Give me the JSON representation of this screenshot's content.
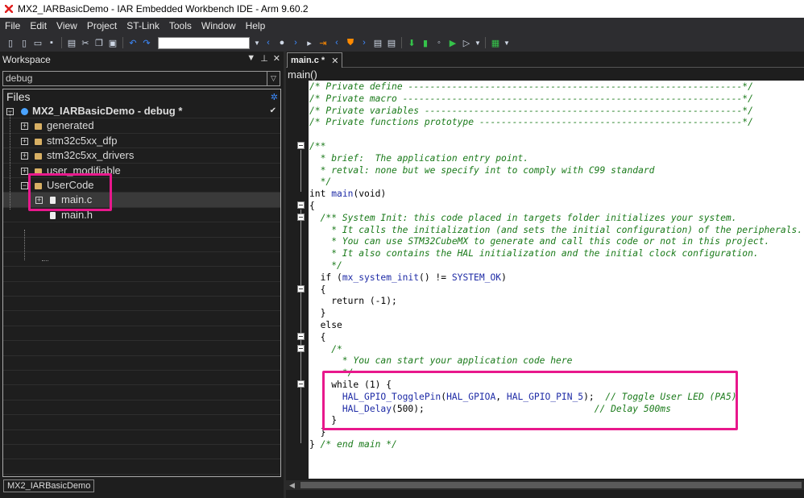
{
  "window": {
    "title": "MX2_IARBasicDemo - IAR Embedded Workbench IDE - Arm 9.60.2"
  },
  "menubar": {
    "items": [
      "File",
      "Edit",
      "View",
      "Project",
      "ST-Link",
      "Tools",
      "Window",
      "Help"
    ]
  },
  "workspace": {
    "header": "Workspace",
    "configuration": "debug",
    "files_header": "Files",
    "tree": [
      {
        "label": "MX2_IARBasicDemo - debug *",
        "kind": "project",
        "level": 0,
        "expander": "minus",
        "bold": true
      },
      {
        "label": "generated",
        "kind": "folder",
        "level": 1,
        "expander": "plus"
      },
      {
        "label": "stm32c5xx_dfp",
        "kind": "folder",
        "level": 1,
        "expander": "plus"
      },
      {
        "label": "stm32c5xx_drivers",
        "kind": "folder",
        "level": 1,
        "expander": "plus"
      },
      {
        "label": "user_modifiable",
        "kind": "folder",
        "level": 1,
        "expander": "plus"
      },
      {
        "label": "UserCode",
        "kind": "folder",
        "level": 1,
        "expander": "minus"
      },
      {
        "label": "main.c",
        "kind": "file",
        "level": 2,
        "expander": "plus",
        "selected": true
      },
      {
        "label": "main.h",
        "kind": "file",
        "level": 2,
        "expander": "none"
      }
    ],
    "bottom_tab": "MX2_IARBasicDemo"
  },
  "editor": {
    "tab_label": "main.c *",
    "function_bar": "main()",
    "code_lines": [
      [
        {
          "t": "/* Private define -------------------------------------------------------------*/",
          "c": "com"
        }
      ],
      [
        {
          "t": "/* Private macro --------------------------------------------------------------*/",
          "c": "com"
        }
      ],
      [
        {
          "t": "/* Private variables ----------------------------------------------------------*/",
          "c": "com"
        }
      ],
      [
        {
          "t": "/* Private functions prototype ------------------------------------------------*/",
          "c": "com"
        }
      ],
      [],
      [
        {
          "t": "/**",
          "c": "com"
        }
      ],
      [
        {
          "t": "  * brief:  The application entry point.",
          "c": "com"
        }
      ],
      [
        {
          "t": "  * retval: none but we specify int to comply with C99 standard",
          "c": "com"
        }
      ],
      [
        {
          "t": "  */",
          "c": "com"
        }
      ],
      [
        {
          "t": "int ",
          "c": "kw"
        },
        {
          "t": "main",
          "c": "fn"
        },
        {
          "t": "(void)",
          "c": "kw"
        }
      ],
      [
        {
          "t": "{",
          "c": "kw"
        }
      ],
      [
        {
          "t": "  /** System Init: this code placed in targets folder initializes your system.",
          "c": "com"
        }
      ],
      [
        {
          "t": "    * It calls the initialization (and sets the initial configuration) of the peripherals.",
          "c": "com"
        }
      ],
      [
        {
          "t": "    * You can use STM32CubeMX to generate and call this code or not in this project.",
          "c": "com"
        }
      ],
      [
        {
          "t": "    * It also contains the HAL initialization and the initial clock configuration.",
          "c": "com"
        }
      ],
      [
        {
          "t": "    */",
          "c": "com"
        }
      ],
      [
        {
          "t": "  if (",
          "c": "kw"
        },
        {
          "t": "mx_system_init",
          "c": "fn"
        },
        {
          "t": "() != ",
          "c": "kw"
        },
        {
          "t": "SYSTEM_OK",
          "c": "mac"
        },
        {
          "t": ")",
          "c": "kw"
        }
      ],
      [
        {
          "t": "  {",
          "c": "kw"
        }
      ],
      [
        {
          "t": "    return (-1);",
          "c": "kw"
        }
      ],
      [
        {
          "t": "  }",
          "c": "kw"
        }
      ],
      [
        {
          "t": "  else",
          "c": "kw"
        }
      ],
      [
        {
          "t": "  {",
          "c": "kw"
        }
      ],
      [
        {
          "t": "    /*",
          "c": "com"
        }
      ],
      [
        {
          "t": "      * You can start your application code here",
          "c": "com"
        }
      ],
      [
        {
          "t": "      */",
          "c": "com"
        }
      ],
      [
        {
          "t": "    while (1) {",
          "c": "kw"
        }
      ],
      [
        {
          "t": "      ",
          "c": "kw"
        },
        {
          "t": "HAL_GPIO_TogglePin",
          "c": "fn"
        },
        {
          "t": "(",
          "c": "kw"
        },
        {
          "t": "HAL_GPIOA",
          "c": "mac"
        },
        {
          "t": ", ",
          "c": "kw"
        },
        {
          "t": "HAL_GPIO_PIN_5",
          "c": "mac"
        },
        {
          "t": ");  ",
          "c": "kw"
        },
        {
          "t": "// Toggle User LED (PA5)",
          "c": "com"
        }
      ],
      [
        {
          "t": "      ",
          "c": "kw"
        },
        {
          "t": "HAL_Delay",
          "c": "fn"
        },
        {
          "t": "(500);                               ",
          "c": "kw"
        },
        {
          "t": "// Delay 500ms",
          "c": "com"
        }
      ],
      [
        {
          "t": "    }",
          "c": "kw"
        }
      ],
      [
        {
          "t": "  }",
          "c": "kw"
        }
      ],
      [
        {
          "t": "} ",
          "c": "kw"
        },
        {
          "t": "/* end main */",
          "c": "com"
        }
      ]
    ]
  },
  "colors": {
    "highlight_box": "#e8188c",
    "comment": "#1a7a1a",
    "identifier": "#1e2ba6"
  }
}
